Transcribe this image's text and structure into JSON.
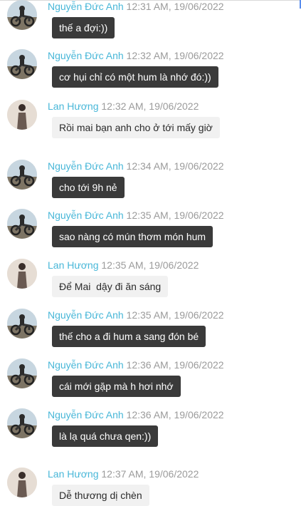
{
  "messages": [
    {
      "sender": "Nguyễn Đức Anh",
      "time": "12:31 AM, 19/06/2022",
      "text": "thế a đợi:))",
      "avatar": "motorbike-avatar",
      "style": "dark"
    },
    {
      "sender": "Nguyễn Đức Anh",
      "time": "12:32 AM, 19/06/2022",
      "text": "cơ hụi chỉ có một hum là nhớ đó:))",
      "avatar": "motorbike-avatar",
      "style": "dark"
    },
    {
      "sender": "Lan Hương",
      "time": "12:32 AM, 19/06/2022",
      "text": "Rồi mai bạn anh cho ở tới mấy giờ",
      "avatar": "person-avatar",
      "style": "light"
    },
    {
      "sender": "Nguyễn Đức Anh",
      "time": "12:34 AM, 19/06/2022",
      "text": "cho tới 9h nẻ",
      "avatar": "motorbike-avatar",
      "style": "dark"
    },
    {
      "sender": "Nguyễn Đức Anh",
      "time": "12:35 AM, 19/06/2022",
      "text": "sao nàng có mún thơm món hum",
      "avatar": "motorbike-avatar",
      "style": "dark"
    },
    {
      "sender": "Lan Hương",
      "time": "12:35 AM, 19/06/2022",
      "text": "Để Mai  dậy đi ăn sáng",
      "avatar": "person-avatar",
      "style": "light"
    },
    {
      "sender": "Nguyễn Đức Anh",
      "time": "12:35 AM, 19/06/2022",
      "text": "thế cho a đi hum a sang đón bé",
      "avatar": "motorbike-avatar",
      "style": "dark"
    },
    {
      "sender": "Nguyễn Đức Anh",
      "time": "12:36 AM, 19/06/2022",
      "text": "cái mới gặp mà h hơi nhớ",
      "avatar": "motorbike-avatar",
      "style": "dark"
    },
    {
      "sender": "Nguyễn Đức Anh",
      "time": "12:36 AM, 19/06/2022",
      "text": "là lạ quá chưa qen:))",
      "avatar": "motorbike-avatar",
      "style": "dark"
    },
    {
      "sender": "Lan Hương",
      "time": "12:37 AM, 19/06/2022",
      "text": "Dễ thương dị chèn",
      "avatar": "person-avatar",
      "style": "light"
    }
  ]
}
